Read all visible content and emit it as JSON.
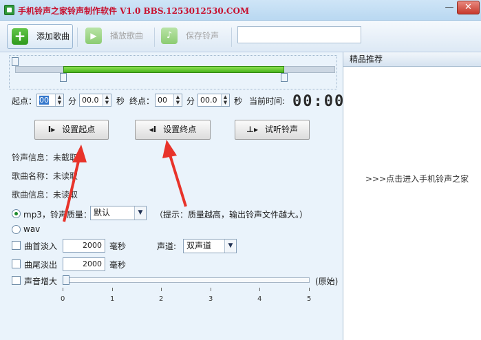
{
  "window": {
    "title": "手机铃声之家铃声制作软件   V1.0   BBS.1253012530.COM",
    "minimize": "—",
    "close": "✕"
  },
  "toolbar": {
    "add_song": "添加歌曲",
    "play_song": "播放歌曲",
    "save_ringtone": "保存铃声",
    "search_value": ""
  },
  "range": {
    "start_label": "起点：",
    "start_min": "00",
    "start_sec": "00.0",
    "end_label": "终点：",
    "end_min": "00",
    "end_sec": "00.0",
    "unit_min": "分",
    "unit_sec": "秒",
    "current_time_label": "当前时间:",
    "current_time": "00:00",
    "start_fraction": 0.15,
    "end_fraction": 0.84
  },
  "actions": {
    "set_start": "设置起点",
    "set_end": "设置终点",
    "preview": "试听铃声"
  },
  "info": {
    "ringtone_info": "铃声信息：未截取",
    "song_name": "歌曲名称：未读取",
    "song_info": "歌曲信息：未读取"
  },
  "format": {
    "mp3_label": "mp3，铃声质量：",
    "quality_value": "默认",
    "hint": "（提示：质量越高，输出铃声文件越大。）",
    "wav_label": "wav",
    "selected": "mp3"
  },
  "effects": {
    "fade_in_label": "曲首淡入",
    "fade_in_value": "2000",
    "fade_out_label": "曲尾淡出",
    "fade_out_value": "2000",
    "ms_unit": "毫秒",
    "channel_label": "声道:",
    "channel_value": "双声道",
    "volume_label": "声音增大",
    "volume_suffix": "(原始)",
    "volume_level": 0,
    "scale_labels": [
      "0",
      "1",
      "2",
      "3",
      "4",
      "5"
    ]
  },
  "sidebar": {
    "header": "精品推荐",
    "link": ">>>点击进入手机铃声之家"
  },
  "colors": {
    "title_red": "#c8102e",
    "selection_green": "#4ab51e",
    "annotation_red": "#e8332a"
  }
}
